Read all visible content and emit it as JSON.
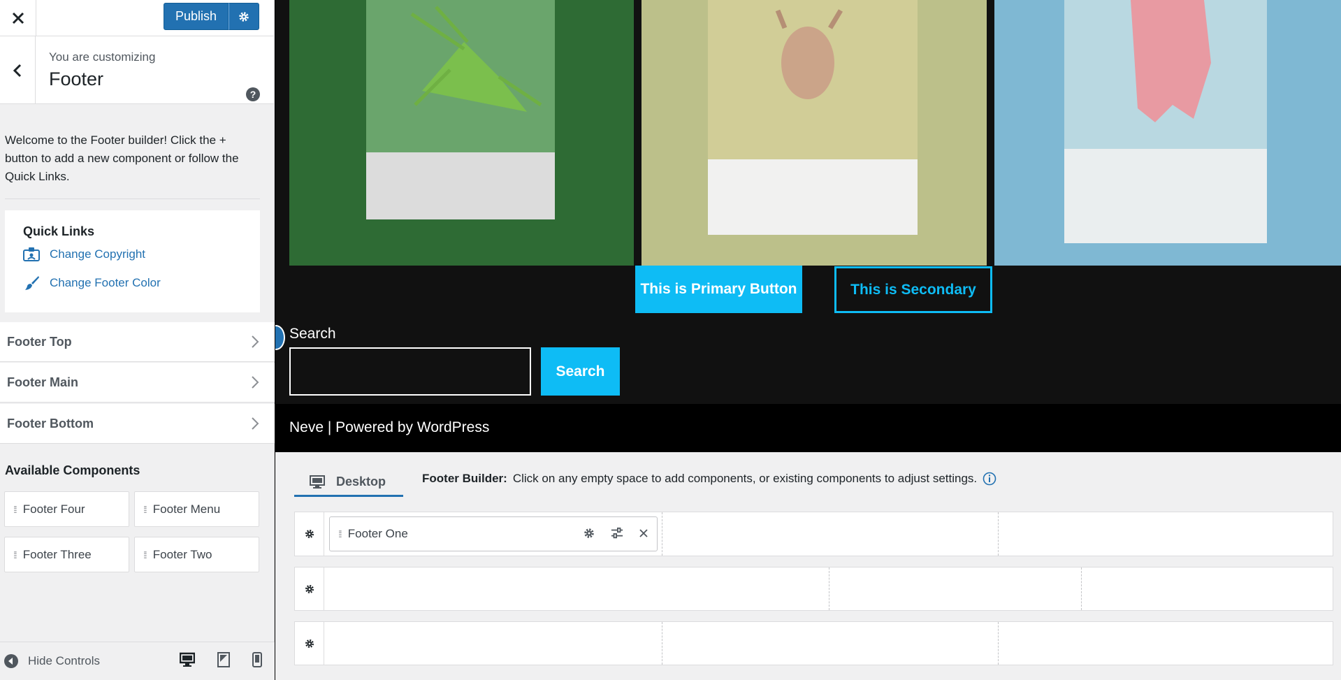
{
  "panel": {
    "publish_label": "Publish",
    "customizing_label": "You are customizing",
    "section_title": "Footer",
    "welcome_text": "Welcome to the Footer builder! Click the + button to add a new component or follow the Quick Links.",
    "quick_links": {
      "title": "Quick Links",
      "items": [
        {
          "label": "Change Copyright",
          "icon": "id-card-icon"
        },
        {
          "label": "Change Footer Color",
          "icon": "paint-brush-icon"
        }
      ]
    },
    "sections": [
      {
        "label": "Footer Top"
      },
      {
        "label": "Footer Main"
      },
      {
        "label": "Footer Bottom"
      }
    ],
    "available_components": {
      "title": "Available Components",
      "items": [
        "Footer Four",
        "Footer Menu",
        "Footer Three",
        "Footer Two"
      ]
    },
    "hide_controls_label": "Hide Controls"
  },
  "preview": {
    "primary_button": "This is Primary Button",
    "secondary_button": "This is Secondary",
    "search_label": "Search",
    "search_value": "",
    "search_button": "Search",
    "powered_by": "Neve | Powered by WordPress",
    "accent_color": "#0ebcf5"
  },
  "builder": {
    "tab_label": "Desktop",
    "note_bold": "Footer Builder:",
    "note_text": "Click on any empty space to add components, or existing components to adjust settings.",
    "placed_component": "Footer One"
  },
  "colors": {
    "wp_blue": "#2271b1",
    "panel_bg": "#f0f0f1"
  }
}
